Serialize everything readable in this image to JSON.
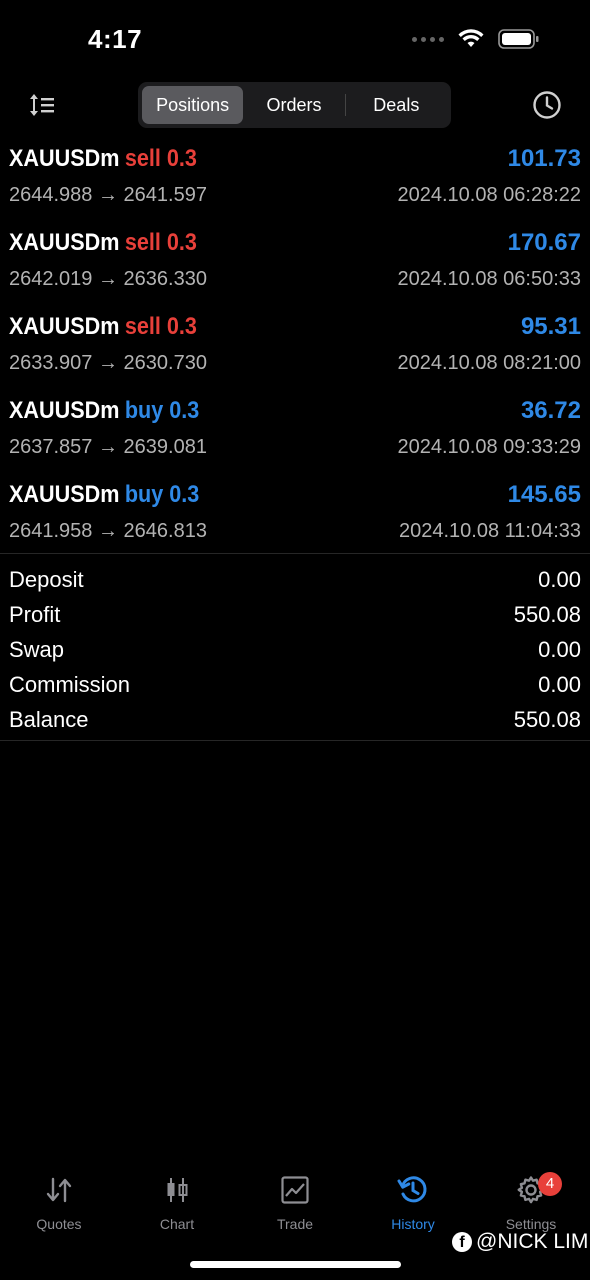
{
  "status": {
    "time": "4:17"
  },
  "tabs": {
    "positions": "Positions",
    "orders": "Orders",
    "deals": "Deals"
  },
  "positions": [
    {
      "symbol": "XAUUSDm",
      "side": "sell 0.3",
      "type": "sell",
      "profit": "101.73",
      "open": "2644.988",
      "close": "2641.597",
      "time": "2024.10.08 06:28:22"
    },
    {
      "symbol": "XAUUSDm",
      "side": "sell 0.3",
      "type": "sell",
      "profit": "170.67",
      "open": "2642.019",
      "close": "2636.330",
      "time": "2024.10.08 06:50:33"
    },
    {
      "symbol": "XAUUSDm",
      "side": "sell 0.3",
      "type": "sell",
      "profit": "95.31",
      "open": "2633.907",
      "close": "2630.730",
      "time": "2024.10.08 08:21:00"
    },
    {
      "symbol": "XAUUSDm",
      "side": "buy 0.3",
      "type": "buy",
      "profit": "36.72",
      "open": "2637.857",
      "close": "2639.081",
      "time": "2024.10.08 09:33:29"
    },
    {
      "symbol": "XAUUSDm",
      "side": "buy 0.3",
      "type": "buy",
      "profit": "145.65",
      "open": "2641.958",
      "close": "2646.813",
      "time": "2024.10.08 11:04:33"
    }
  ],
  "arrow": "→",
  "summary": [
    {
      "label": "Deposit",
      "value": "0.00"
    },
    {
      "label": "Profit",
      "value": "550.08"
    },
    {
      "label": "Swap",
      "value": "0.00"
    },
    {
      "label": "Commission",
      "value": "0.00"
    },
    {
      "label": "Balance",
      "value": "550.08"
    }
  ],
  "tabbar": {
    "quotes": "Quotes",
    "chart": "Chart",
    "trade": "Trade",
    "history": "History",
    "settings": "Settings",
    "settings_badge": "4"
  },
  "watermark": {
    "fb": "f",
    "text": "@NICK LIM"
  },
  "colors": {
    "sell": "#e8403a",
    "buy": "#2f89e6",
    "accent": "#2f89e6"
  }
}
